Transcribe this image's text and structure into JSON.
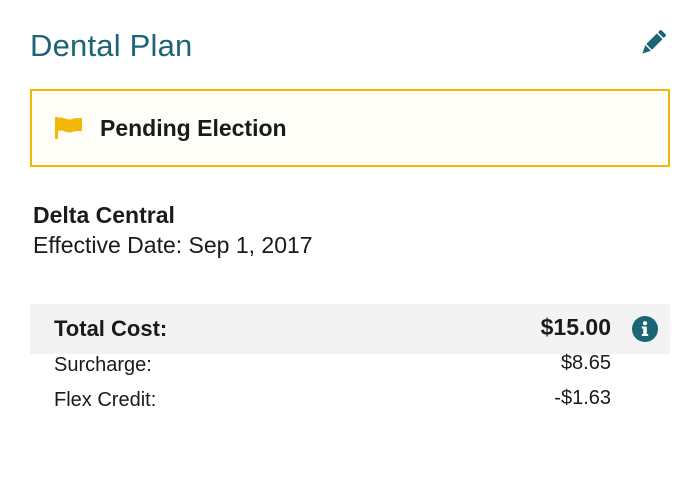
{
  "header": {
    "title": "Dental Plan",
    "edit_icon": "pencil-icon"
  },
  "status": {
    "icon": "flag-icon",
    "text": "Pending Election",
    "accent_color": "#f2b807"
  },
  "plan": {
    "carrier": "Delta Central",
    "effective_date": "Effective Date: Sep 1, 2017"
  },
  "costs": {
    "total_label": "Total Cost:",
    "total_value": "$15.00",
    "info_icon": "info-icon",
    "items": [
      {
        "label": "Surcharge:",
        "value": "$8.65"
      },
      {
        "label": "Flex Credit:",
        "value": "-$1.63"
      }
    ]
  },
  "colors": {
    "brand": "#1b6574",
    "warning": "#f2b807",
    "row_background": "#f3f3f3"
  }
}
